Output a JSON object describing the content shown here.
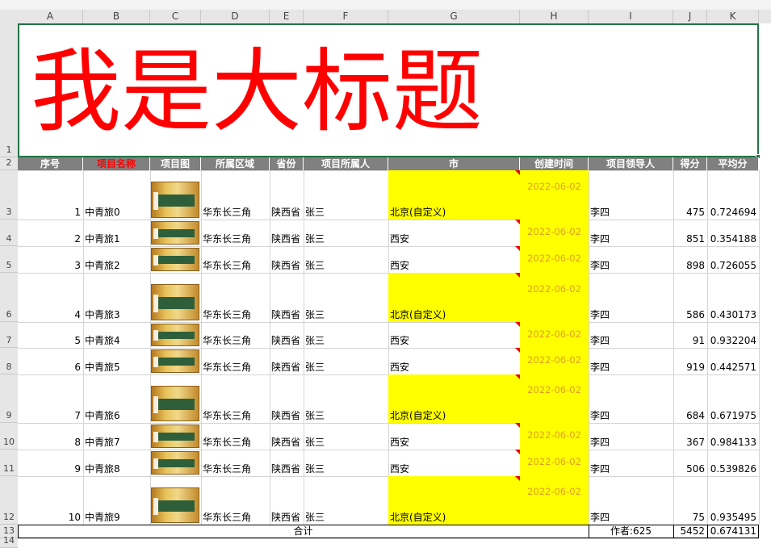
{
  "columns": [
    "A",
    "B",
    "C",
    "D",
    "E",
    "F",
    "G",
    "H",
    "I",
    "J",
    "K"
  ],
  "row_numbers": [
    "1",
    "2",
    "3",
    "4",
    "5",
    "6",
    "7",
    "8",
    "9",
    "10",
    "11",
    "12",
    "13",
    "14"
  ],
  "title": "我是大标题",
  "headers": [
    "序号",
    "项目名称",
    "项目图",
    "所属区域",
    "省份",
    "项目所属人",
    "市",
    "创建时间",
    "项目领导人",
    "得分",
    "平均分"
  ],
  "rows": [
    {
      "no": "1",
      "name": "中青旅0",
      "region": "华东长三角",
      "province": "陕西省",
      "owner": "张三",
      "city": "北京(自定义)",
      "date": "2022-06-02",
      "leader": "李四",
      "score": "475",
      "avg": "0.724694"
    },
    {
      "no": "2",
      "name": "中青旅1",
      "region": "华东长三角",
      "province": "陕西省",
      "owner": "张三",
      "city": "西安",
      "date": "2022-06-02",
      "leader": "李四",
      "score": "851",
      "avg": "0.354188"
    },
    {
      "no": "3",
      "name": "中青旅2",
      "region": "华东长三角",
      "province": "陕西省",
      "owner": "张三",
      "city": "西安",
      "date": "2022-06-02",
      "leader": "李四",
      "score": "898",
      "avg": "0.726055"
    },
    {
      "no": "4",
      "name": "中青旅3",
      "region": "华东长三角",
      "province": "陕西省",
      "owner": "张三",
      "city": "北京(自定义)",
      "date": "2022-06-02",
      "leader": "李四",
      "score": "586",
      "avg": "0.430173"
    },
    {
      "no": "5",
      "name": "中青旅4",
      "region": "华东长三角",
      "province": "陕西省",
      "owner": "张三",
      "city": "西安",
      "date": "2022-06-02",
      "leader": "李四",
      "score": "91",
      "avg": "0.932204"
    },
    {
      "no": "6",
      "name": "中青旅5",
      "region": "华东长三角",
      "province": "陕西省",
      "owner": "张三",
      "city": "西安",
      "date": "2022-06-02",
      "leader": "李四",
      "score": "919",
      "avg": "0.442571"
    },
    {
      "no": "7",
      "name": "中青旅6",
      "region": "华东长三角",
      "province": "陕西省",
      "owner": "张三",
      "city": "北京(自定义)",
      "date": "2022-06-02",
      "leader": "李四",
      "score": "684",
      "avg": "0.671975"
    },
    {
      "no": "8",
      "name": "中青旅7",
      "region": "华东长三角",
      "province": "陕西省",
      "owner": "张三",
      "city": "西安",
      "date": "2022-06-02",
      "leader": "李四",
      "score": "367",
      "avg": "0.984133"
    },
    {
      "no": "9",
      "name": "中青旅8",
      "region": "华东长三角",
      "province": "陕西省",
      "owner": "张三",
      "city": "西安",
      "date": "2022-06-02",
      "leader": "李四",
      "score": "506",
      "avg": "0.539826"
    },
    {
      "no": "10",
      "name": "中青旅9",
      "region": "华东长三角",
      "province": "陕西省",
      "owner": "张三",
      "city": "北京(自定义)",
      "date": "2022-06-02",
      "leader": "李四",
      "score": "75",
      "avg": "0.935495"
    }
  ],
  "total": {
    "label": "合计",
    "author": "作者:625",
    "score": "5452",
    "avg": "0.674131"
  },
  "colors": {
    "title": "#ff0000",
    "header_bg": "#808080",
    "highlight": "#ffff00",
    "date_text": "#e0a020",
    "selection": "#217346"
  }
}
